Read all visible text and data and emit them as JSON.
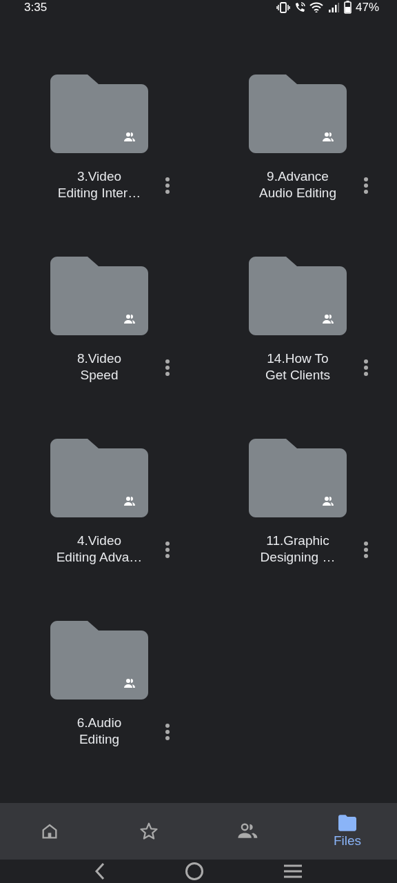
{
  "status_bar": {
    "time": "3:35",
    "battery": "47%"
  },
  "folders": [
    {
      "name_lines": [
        "3.Video",
        "Editing Inter…"
      ],
      "shared": true
    },
    {
      "name_lines": [
        "9.Advance",
        "Audio Editing"
      ],
      "shared": true
    },
    {
      "name_lines": [
        "8.Video",
        "Speed"
      ],
      "shared": true
    },
    {
      "name_lines": [
        "14.How To",
        "Get Clients"
      ],
      "shared": true
    },
    {
      "name_lines": [
        "4.Video",
        "Editing Adva…"
      ],
      "shared": true
    },
    {
      "name_lines": [
        "11.Graphic",
        "Designing …"
      ],
      "shared": true
    },
    {
      "name_lines": [
        "6.Audio",
        "Editing"
      ],
      "shared": true
    }
  ],
  "bottom_nav": [
    {
      "kind": "home",
      "selected": false
    },
    {
      "kind": "starred",
      "selected": false
    },
    {
      "kind": "shared",
      "selected": false
    },
    {
      "kind": "files",
      "label": "Files",
      "selected": true
    }
  ],
  "system_nav": [
    {
      "kind": "back"
    },
    {
      "kind": "home"
    },
    {
      "kind": "recents"
    }
  ]
}
